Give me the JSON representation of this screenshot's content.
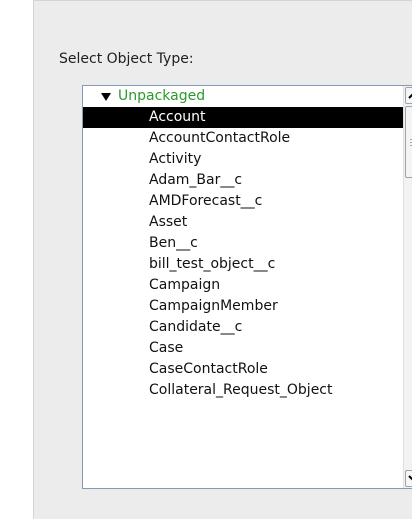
{
  "panel": {
    "label": "Select Object Type:"
  },
  "list": {
    "group": {
      "label": "Unpackaged",
      "color": "#2a9a2a"
    },
    "selected_index": 0,
    "items": [
      "Account",
      "AccountContactRole",
      "Activity",
      "Adam_Bar__c",
      "AMDForecast__c",
      "Asset",
      "Ben__c",
      "bill_test_object__c",
      "Campaign",
      "CampaignMember",
      "Candidate__c",
      "Case",
      "CaseContactRole",
      "Collateral_Request_Object"
    ]
  },
  "scrollbar": {
    "up_icon": "chevron-up-icon",
    "down_icon": "chevron-down-icon",
    "grip_icon": "grip-icon"
  },
  "colors": {
    "selection_bg": "#000000",
    "selection_text": "#ffffff",
    "panel_bg": "#ececec",
    "listbox_border": "#7f9db9"
  }
}
